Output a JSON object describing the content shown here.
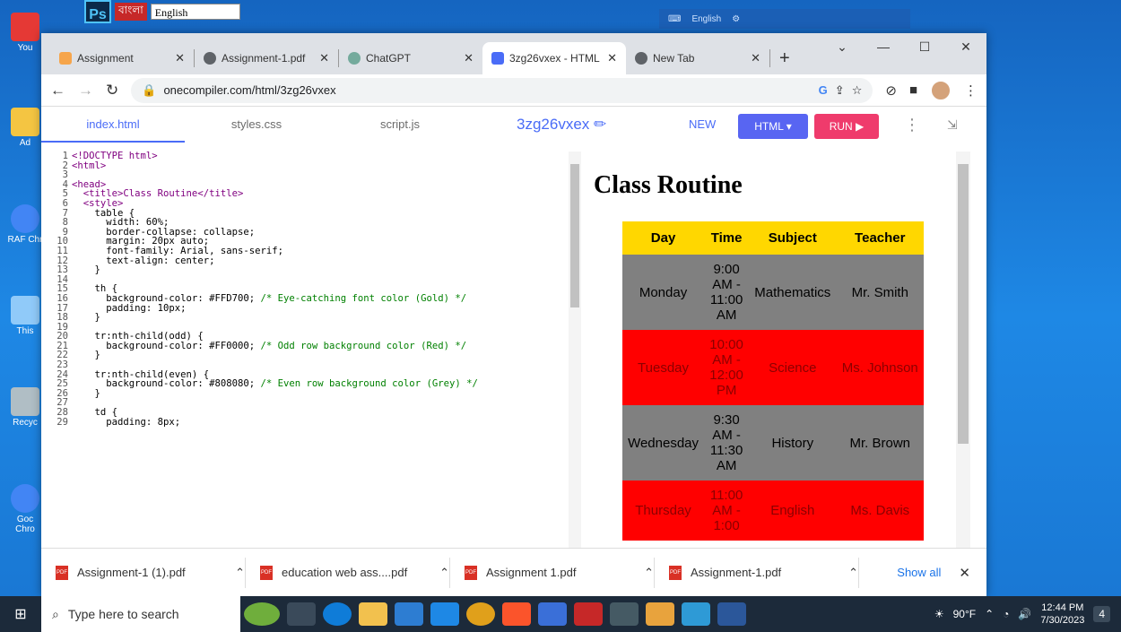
{
  "topbar": {
    "app": "Ps",
    "ban": "বাংলা",
    "lang": "English"
  },
  "langbar": {
    "label": "English"
  },
  "desktop_icons": [
    "You",
    "Ad",
    "RAF Chr",
    "This",
    "Recyc",
    "Goc Chro"
  ],
  "browser": {
    "tabs": [
      {
        "label": "Assignment",
        "color": "#f6a54b"
      },
      {
        "label": "Assignment-1.pdf",
        "color": "#5f6368"
      },
      {
        "label": "ChatGPT",
        "color": "#74aa9c"
      },
      {
        "label": "3zg26vxex - HTML",
        "color": "#4a6cf7"
      },
      {
        "label": "New Tab",
        "color": "#5f6368"
      }
    ],
    "url": "onecompiler.com/html/3zg26vxex"
  },
  "editor": {
    "tabs": [
      "index.html",
      "styles.css",
      "script.js"
    ],
    "project": "3zg26vxex",
    "new": "NEW",
    "html_btn": "HTML ▾",
    "run_btn": "RUN ▶",
    "code": [
      [
        "1",
        "<!DOCTYPE html>"
      ],
      [
        "2",
        "<html>"
      ],
      [
        "3",
        ""
      ],
      [
        "4",
        "<head>"
      ],
      [
        "5",
        "  <title>Class Routine</title>"
      ],
      [
        "6",
        "  <style>"
      ],
      [
        "7",
        "    table {"
      ],
      [
        "8",
        "      width: 60%;"
      ],
      [
        "9",
        "      border-collapse: collapse;"
      ],
      [
        "10",
        "      margin: 20px auto;"
      ],
      [
        "11",
        "      font-family: Arial, sans-serif;"
      ],
      [
        "12",
        "      text-align: center;"
      ],
      [
        "13",
        "    }"
      ],
      [
        "14",
        ""
      ],
      [
        "15",
        "    th {"
      ],
      [
        "16",
        "      background-color: #FFD700; /* Eye-catching font color (Gold) */"
      ],
      [
        "17",
        "      padding: 10px;"
      ],
      [
        "18",
        "    }"
      ],
      [
        "19",
        ""
      ],
      [
        "20",
        "    tr:nth-child(odd) {"
      ],
      [
        "21",
        "      background-color: #FF0000; /* Odd row background color (Red) */"
      ],
      [
        "22",
        "    }"
      ],
      [
        "23",
        ""
      ],
      [
        "24",
        "    tr:nth-child(even) {"
      ],
      [
        "25",
        "      background-color: #808080; /* Even row background color (Grey) */"
      ],
      [
        "26",
        "    }"
      ],
      [
        "27",
        ""
      ],
      [
        "28",
        "    td {"
      ],
      [
        "29",
        "      padding: 8px;"
      ]
    ]
  },
  "preview": {
    "heading": "Class Routine",
    "headers": [
      "Day",
      "Time",
      "Subject",
      "Teacher"
    ],
    "rows": [
      {
        "day": "Monday",
        "time": "9:00 AM - 11:00 AM",
        "subject": "Mathematics",
        "teacher": "Mr. Smith",
        "style": "grey"
      },
      {
        "day": "Tuesday",
        "time": "10:00 AM - 12:00 PM",
        "subject": "Science",
        "teacher": "Ms. Johnson",
        "style": "red"
      },
      {
        "day": "Wednesday",
        "time": "9:30 AM - 11:30 AM",
        "subject": "History",
        "teacher": "Mr. Brown",
        "style": "grey"
      },
      {
        "day": "Thursday",
        "time": "11:00 AM - 1:00",
        "subject": "English",
        "teacher": "Ms. Davis",
        "style": "red"
      }
    ]
  },
  "downloads": {
    "items": [
      "Assignment-1 (1).pdf",
      "education web ass....pdf",
      "Assignment 1.pdf",
      "Assignment-1.pdf"
    ],
    "show_all": "Show all"
  },
  "taskbar": {
    "search": "Type here to search",
    "weather": "90°F",
    "time": "12:44 PM",
    "date": "7/30/2023",
    "notif": "4"
  }
}
